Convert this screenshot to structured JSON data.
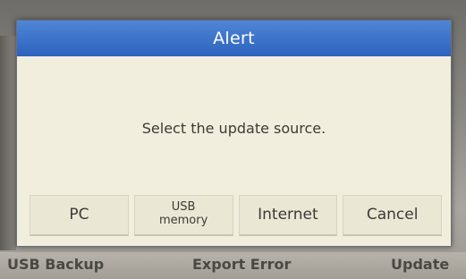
{
  "dialog": {
    "title": "Alert",
    "message": "Select the update source.",
    "buttons": {
      "pc": "PC",
      "usb_line1": "USB",
      "usb_line2": "memory",
      "internet": "Internet",
      "cancel": "Cancel"
    }
  },
  "background": {
    "bottom_bar": {
      "left": "USB Backup",
      "center": "Export Error",
      "right": "Update"
    }
  }
}
